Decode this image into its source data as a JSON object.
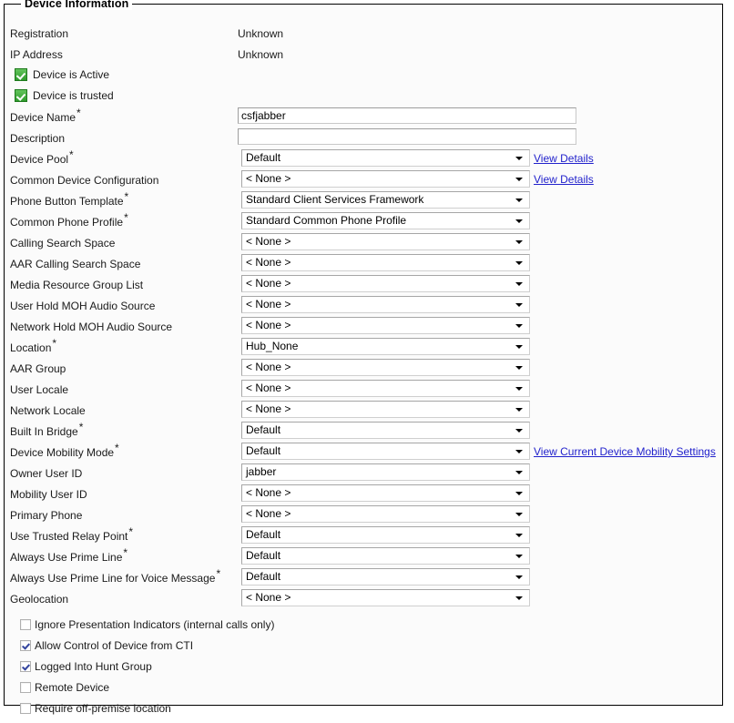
{
  "panel": {
    "legend": "Device Information"
  },
  "static_fields": [
    {
      "label": "Registration",
      "value": "Unknown"
    },
    {
      "label": "IP Address",
      "value": "Unknown"
    }
  ],
  "status_flags": [
    {
      "label": "Device is Active",
      "icon": "green-check-icon",
      "checked": true
    },
    {
      "label": "Device is trusted",
      "icon": "green-check-icon",
      "checked": true
    }
  ],
  "text_fields": [
    {
      "label": "Device Name",
      "required": true,
      "value": "csfjabber",
      "placeholder": ""
    },
    {
      "label": "Description",
      "required": false,
      "value": "",
      "placeholder": ""
    }
  ],
  "dropdowns": [
    {
      "label": "Device Pool",
      "required": true,
      "value": "Default",
      "link": "View Details"
    },
    {
      "label": "Common Device Configuration",
      "required": false,
      "value": "< None >",
      "link": "View Details"
    },
    {
      "label": "Phone Button Template",
      "required": true,
      "value": "Standard Client Services Framework",
      "link": ""
    },
    {
      "label": "Common Phone Profile",
      "required": true,
      "value": "Standard Common Phone Profile",
      "link": ""
    },
    {
      "label": "Calling Search Space",
      "required": false,
      "value": "< None >",
      "link": ""
    },
    {
      "label": "AAR Calling Search Space",
      "required": false,
      "value": "< None >",
      "link": ""
    },
    {
      "label": "Media Resource Group List",
      "required": false,
      "value": "< None >",
      "link": ""
    },
    {
      "label": "User Hold MOH Audio Source",
      "required": false,
      "value": "< None >",
      "link": ""
    },
    {
      "label": "Network Hold MOH Audio Source",
      "required": false,
      "value": "< None >",
      "link": ""
    },
    {
      "label": "Location",
      "required": true,
      "value": "Hub_None",
      "link": ""
    },
    {
      "label": "AAR Group",
      "required": false,
      "value": "< None >",
      "link": ""
    },
    {
      "label": "User Locale",
      "required": false,
      "value": "< None >",
      "link": ""
    },
    {
      "label": "Network Locale",
      "required": false,
      "value": "< None >",
      "link": ""
    },
    {
      "label": "Built In Bridge",
      "required": true,
      "value": "Default",
      "link": ""
    },
    {
      "label": "Device Mobility Mode",
      "required": true,
      "value": "Default",
      "link": "View Current Device Mobility Settings"
    },
    {
      "label": "Owner User ID",
      "required": false,
      "value": "jabber",
      "link": ""
    },
    {
      "label": "Mobility User ID",
      "required": false,
      "value": "< None >",
      "link": ""
    },
    {
      "label": "Primary Phone",
      "required": false,
      "value": "< None >",
      "link": ""
    },
    {
      "label": "Use Trusted Relay Point",
      "required": true,
      "value": "Default",
      "link": ""
    },
    {
      "label": "Always Use Prime Line",
      "required": true,
      "value": "Default",
      "link": ""
    },
    {
      "label": "Always Use Prime Line for Voice Message",
      "required": true,
      "value": "Default",
      "link": ""
    },
    {
      "label": "Geolocation",
      "required": false,
      "value": "< None >",
      "link": ""
    }
  ],
  "checkboxes": [
    {
      "label": "Ignore Presentation Indicators (internal calls only)",
      "checked": false
    },
    {
      "label": "Allow Control of Device from CTI",
      "checked": true
    },
    {
      "label": "Logged Into Hunt Group",
      "checked": true
    },
    {
      "label": "Remote Device",
      "checked": false
    },
    {
      "label": "Require off-premise location",
      "checked": false
    }
  ],
  "colors": {
    "link": "#2222cc",
    "active_check": "#2f9a2c",
    "checkbox_check": "#33449e",
    "panel_bg": "#fbfbfb"
  }
}
